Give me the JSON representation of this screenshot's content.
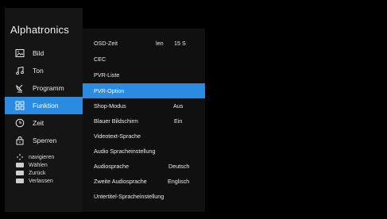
{
  "brand": "Alphatronics",
  "sidebar": {
    "items": [
      {
        "label": "Bild",
        "icon": "picture-icon"
      },
      {
        "label": "Ton",
        "icon": "music-note-icon"
      },
      {
        "label": "Programm",
        "icon": "satellite-dish-icon"
      },
      {
        "label": "Funktion",
        "icon": "function-grid-icon",
        "active": true
      },
      {
        "label": "Zeit",
        "icon": "clock-icon"
      },
      {
        "label": "Sperren",
        "icon": "lock-icon"
      }
    ]
  },
  "help": {
    "navigate": "navigieren",
    "select": "Wählen",
    "back": "Zurück",
    "exit": "Verlassen"
  },
  "menu": {
    "items": [
      {
        "label": "OSD-Zeit",
        "value1": "len",
        "value2": "15 S"
      },
      {
        "label": "CEC"
      },
      {
        "label": "PVR-Liste"
      },
      {
        "label": "PVR-Option",
        "active": true
      },
      {
        "label": "Shop-Modus",
        "value": "Aus"
      },
      {
        "label": "Blauer Bildschirm",
        "value": "Ein"
      },
      {
        "label": "Videotext-Sprache"
      },
      {
        "label": "Audio Spracheinstellung"
      },
      {
        "label": "Audiosprache",
        "value": "Deutsch"
      },
      {
        "label": "Zweite Audiosprache",
        "value": "Englisch"
      },
      {
        "label": "Untertitel-Spracheinstellung"
      }
    ]
  },
  "colors": {
    "accent": "#2a8be0",
    "sidebar_bg": "#151515",
    "panel_bg": "#101010"
  }
}
